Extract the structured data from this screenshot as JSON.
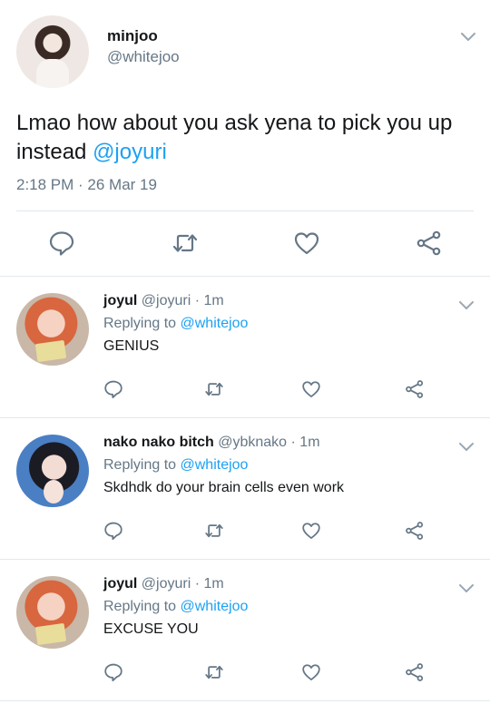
{
  "main_tweet": {
    "name": "minjoo",
    "handle": "@whitejoo",
    "text": "Lmao how about you ask yena to pick you up instead ",
    "mention": "@joyuri",
    "timestamp": "2:18 PM · 26 Mar 19"
  },
  "replies": [
    {
      "name": "joyul",
      "meta": " @joyuri · 1m",
      "replying_prefix": "Replying to ",
      "replying_to": "@whitejoo",
      "text": "GENIUS"
    },
    {
      "name": "nako nako bitch",
      "meta": " @ybknako · 1m",
      "replying_prefix": "Replying to ",
      "replying_to": "@whitejoo",
      "text": "Skdhdk do your brain cells even work"
    },
    {
      "name": "joyul",
      "meta": " @joyuri · 1m",
      "replying_prefix": "Replying to ",
      "replying_to": "@whitejoo",
      "text": "EXCUSE YOU"
    }
  ],
  "colors": {
    "accent": "#1da1f2",
    "muted": "#657786",
    "divider": "#e1e8ed",
    "icon": "#657786"
  },
  "icons": [
    "reply-icon",
    "retweet-icon",
    "like-icon",
    "share-icon",
    "chevron-down-icon"
  ]
}
